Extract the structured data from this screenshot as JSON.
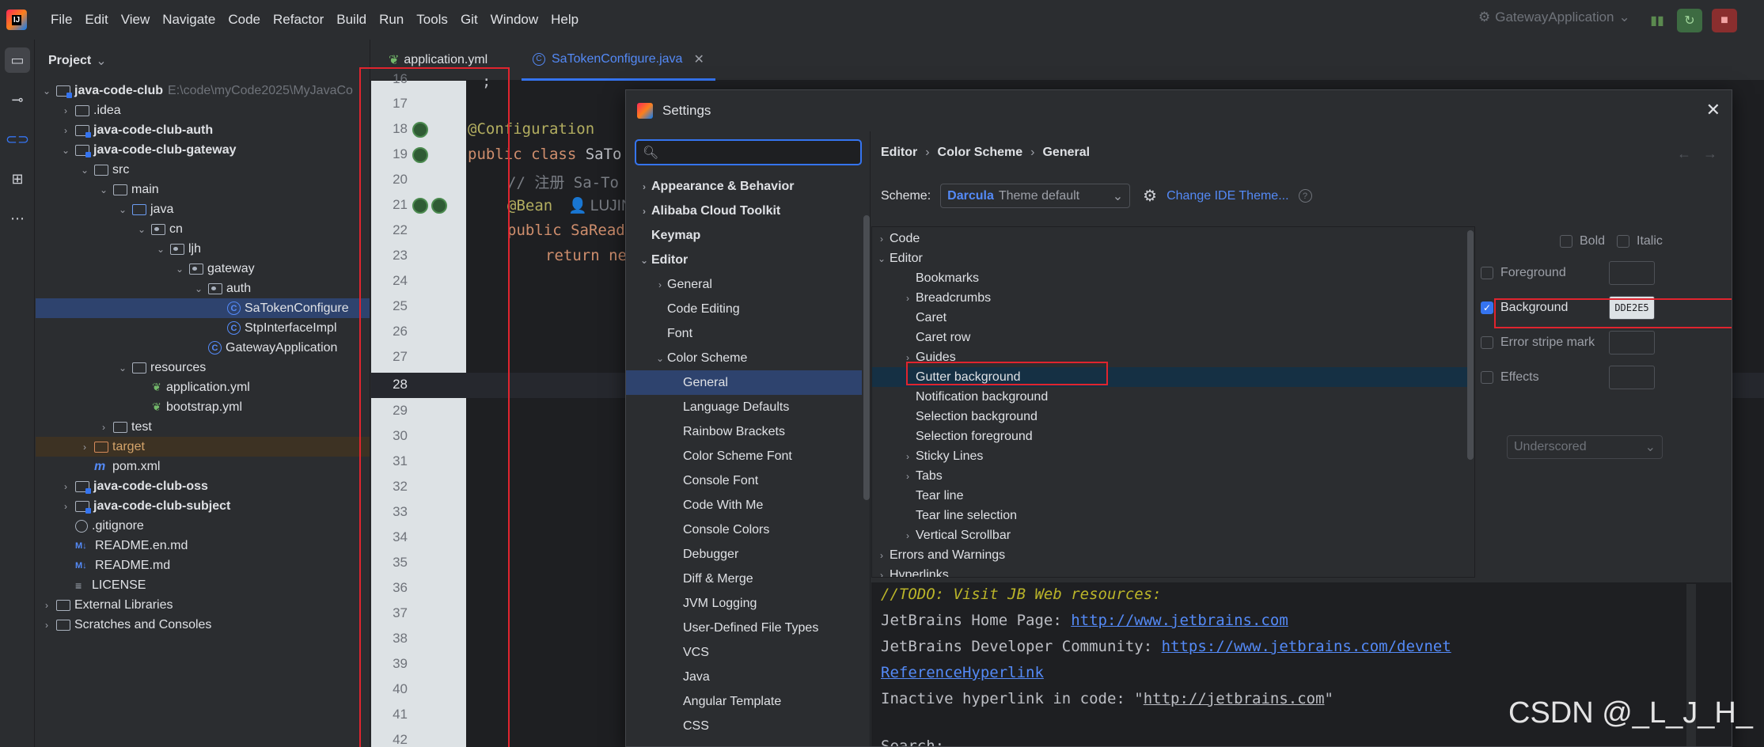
{
  "menu": [
    "File",
    "Edit",
    "View",
    "Navigate",
    "Code",
    "Refactor",
    "Build",
    "Run",
    "Tools",
    "Git",
    "Window",
    "Help"
  ],
  "run_config": "GatewayApplication",
  "project": {
    "title": "Project",
    "tree": [
      {
        "label": "java-code-club",
        "hint": "E:\\code\\myCode2025\\MyJavaCo",
        "bold": true
      },
      {
        "label": ".idea"
      },
      {
        "label": "java-code-club-auth",
        "bold": true
      },
      {
        "label": "java-code-club-gateway",
        "bold": true
      },
      {
        "label": "src"
      },
      {
        "label": "main"
      },
      {
        "label": "java"
      },
      {
        "label": "cn"
      },
      {
        "label": "ljh"
      },
      {
        "label": "gateway"
      },
      {
        "label": "auth"
      },
      {
        "label": "SaTokenConfigure"
      },
      {
        "label": "StpInterfaceImpl"
      },
      {
        "label": "GatewayApplication"
      },
      {
        "label": "resources"
      },
      {
        "label": "application.yml"
      },
      {
        "label": "bootstrap.yml"
      },
      {
        "label": "test"
      },
      {
        "label": "target"
      },
      {
        "label": "pom.xml"
      },
      {
        "label": "java-code-club-oss",
        "bold": true
      },
      {
        "label": "java-code-club-subject",
        "bold": true
      },
      {
        "label": ".gitignore"
      },
      {
        "label": "README.en.md"
      },
      {
        "label": "README.md"
      },
      {
        "label": "LICENSE"
      },
      {
        "label": "External Libraries"
      },
      {
        "label": "Scratches and Consoles"
      }
    ]
  },
  "tabs": {
    "tab1": "application.yml",
    "tab2": "SaTokenConfigure.java"
  },
  "editor": {
    "line_numbers": [
      "16",
      "17",
      "18",
      "19",
      "20",
      "21",
      "22",
      "23",
      "24",
      "25",
      "26",
      "27",
      "28",
      "29",
      "30",
      "31",
      "32",
      "33",
      "34",
      "35",
      "36",
      "37",
      "38",
      "39",
      "40",
      "41",
      "42"
    ],
    "lines": {
      "l15": ";",
      "l18": "@Configuration",
      "l19a": "public class ",
      "l19b": "SaTo",
      "l20": "// 注册 Sa-To",
      "l21a": "@Bean",
      "l21b": "LUJIN",
      "l22": "public SaRead",
      "l23": "return ne"
    }
  },
  "settings": {
    "title": "Settings",
    "nav": [
      {
        "label": "Appearance & Behavior",
        "bold": true
      },
      {
        "label": "Alibaba Cloud Toolkit",
        "bold": true
      },
      {
        "label": "Keymap",
        "bold": true
      },
      {
        "label": "Editor",
        "bold": true
      },
      {
        "label": "General"
      },
      {
        "label": "Code Editing"
      },
      {
        "label": "Font"
      },
      {
        "label": "Color Scheme"
      },
      {
        "label": "General"
      },
      {
        "label": "Language Defaults"
      },
      {
        "label": "Rainbow Brackets"
      },
      {
        "label": "Color Scheme Font"
      },
      {
        "label": "Console Font"
      },
      {
        "label": "Code With Me"
      },
      {
        "label": "Console Colors"
      },
      {
        "label": "Debugger"
      },
      {
        "label": "Diff & Merge"
      },
      {
        "label": "JVM Logging"
      },
      {
        "label": "User-Defined File Types"
      },
      {
        "label": "VCS"
      },
      {
        "label": "Java"
      },
      {
        "label": "Angular Template"
      },
      {
        "label": "CSS"
      }
    ],
    "breadcrumb": [
      "Editor",
      "Color Scheme",
      "General"
    ],
    "scheme_label": "Scheme:",
    "scheme_name": "Darcula",
    "scheme_sub": "Theme default",
    "change_theme": "Change IDE Theme...",
    "tree": [
      {
        "label": "Code"
      },
      {
        "label": "Editor"
      },
      {
        "label": "Bookmarks"
      },
      {
        "label": "Breadcrumbs"
      },
      {
        "label": "Caret"
      },
      {
        "label": "Caret row"
      },
      {
        "label": "Guides"
      },
      {
        "label": "Gutter background"
      },
      {
        "label": "Notification background"
      },
      {
        "label": "Selection background"
      },
      {
        "label": "Selection foreground"
      },
      {
        "label": "Sticky Lines"
      },
      {
        "label": "Tabs"
      },
      {
        "label": "Tear line"
      },
      {
        "label": "Tear line selection"
      },
      {
        "label": "Vertical Scrollbar"
      },
      {
        "label": "Errors and Warnings"
      },
      {
        "label": "Hyperlinks"
      }
    ],
    "attrs": {
      "bold": "Bold",
      "italic": "Italic",
      "foreground": "Foreground",
      "background": "Background",
      "background_value": "DDE2E5",
      "error_stripe": "Error stripe mark",
      "effects": "Effects",
      "effect_type": "Underscored"
    },
    "preview": {
      "todo": "//TODO: Visit JB Web resources:",
      "home_label": "JetBrains Home Page: ",
      "home_link": "http://www.jetbrains.com",
      "dev_label": "JetBrains Developer Community: ",
      "dev_link": "https://www.jetbrains.com/devnet",
      "ref": "ReferenceHyperlink",
      "inactive_a": "Inactive hyperlink in code: \"",
      "inactive_b": "http://jetbrains.com",
      "inactive_c": "\"",
      "search": "Search:"
    }
  },
  "colors": {
    "gutter_background": "#dde2e5",
    "accent": "#3574f0",
    "annotation_red": "#e0242e"
  },
  "watermark": "CSDN @_L_J_H_"
}
